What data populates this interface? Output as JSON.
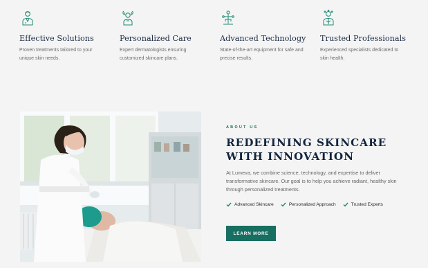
{
  "features": [
    {
      "icon": "dermatologist-icon",
      "title": "Effective Solutions",
      "desc": "Proven treatments tailored to your unique skin needs."
    },
    {
      "icon": "care-person-icon",
      "title": "Personalized Care",
      "desc": "Expert dermatologists ensuring customized skincare plans."
    },
    {
      "icon": "technology-tree-icon",
      "title": "Advanced Technology",
      "desc": "State-of-the-art equipment for safe and precise results."
    },
    {
      "icon": "professional-icon",
      "title": "Trusted Professionals",
      "desc": "Experienced specialists dedicated to skin health."
    }
  ],
  "about": {
    "eyebrow": "ABOUT US",
    "headline_line1": "REDEFINING SKINCARE",
    "headline_line2": "WITH INNOVATION",
    "paragraph": "At Lumeva, we combine science, technology, and expertise to deliver transformative skincare. Our goal is to help you achieve radiant, healthy skin through personalized treatments.",
    "checks": [
      "Advanced Skincare",
      "Personalized Approach",
      "Trusted Experts"
    ],
    "cta_label": "LEARN MORE"
  },
  "colors": {
    "accent": "#176f61",
    "heading": "#12243d",
    "background": "#f4f4f4"
  }
}
